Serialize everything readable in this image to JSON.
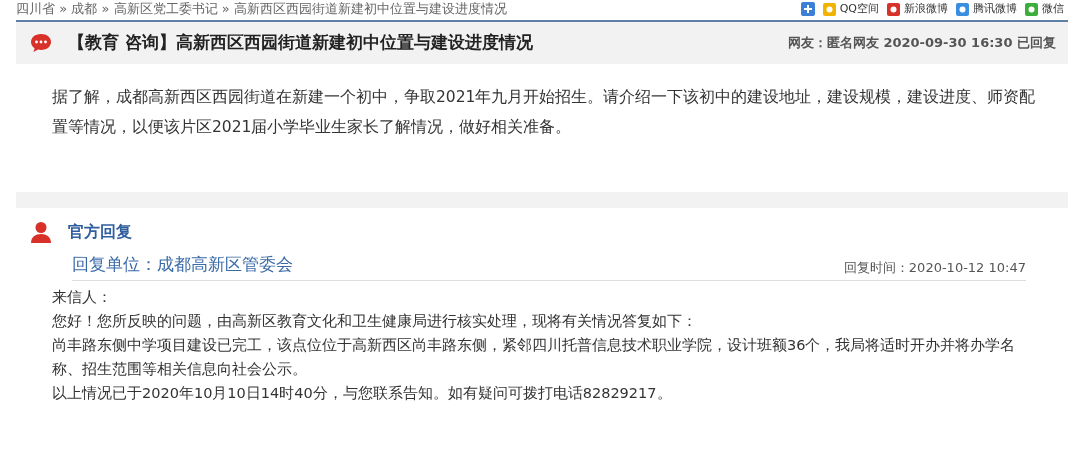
{
  "breadcrumb": {
    "separator": "»",
    "items": [
      "四川省",
      "成都",
      "高新区党工委书记",
      "高新西区西园街道新建初中位置与建设进度情况"
    ]
  },
  "share": [
    "QQ空间",
    "新浪微博",
    "腾讯微博",
    "微信"
  ],
  "question": {
    "title": "【教育 咨询】高新西区西园街道新建初中位置与建设进度情况",
    "meta": "网友：匿名网友  2020-09-30 16:30 已回复",
    "body": "据了解，成都高新西区西园街道在新建一个初中，争取2021年九月开始招生。请介绍一下该初中的建设地址，建设规模，建设进度、师资配置等情况，以便该片区2021届小学毕业生家长了解情况，做好相关准备。"
  },
  "reply": {
    "heading": "官方回复",
    "unit": "回复单位：成都高新区管委会",
    "time": "回复时间：2020-10-12 10:47",
    "paragraphs": [
      "来信人：",
      "您好！您所反映的问题，由高新区教育文化和卫生健康局进行核实处理，现将有关情况答复如下：",
      "尚丰路东侧中学项目建设已完工，该点位位于高新西区尚丰路东侧，紧邻四川托普信息技术职业学院，设计班额36个，我局将适时开办并将办学名称、招生范围等相关信息向社会公示。",
      "以上情况已于2020年10月10日14时40分，与您联系告知。如有疑问可拨打电话82829217。"
    ]
  }
}
